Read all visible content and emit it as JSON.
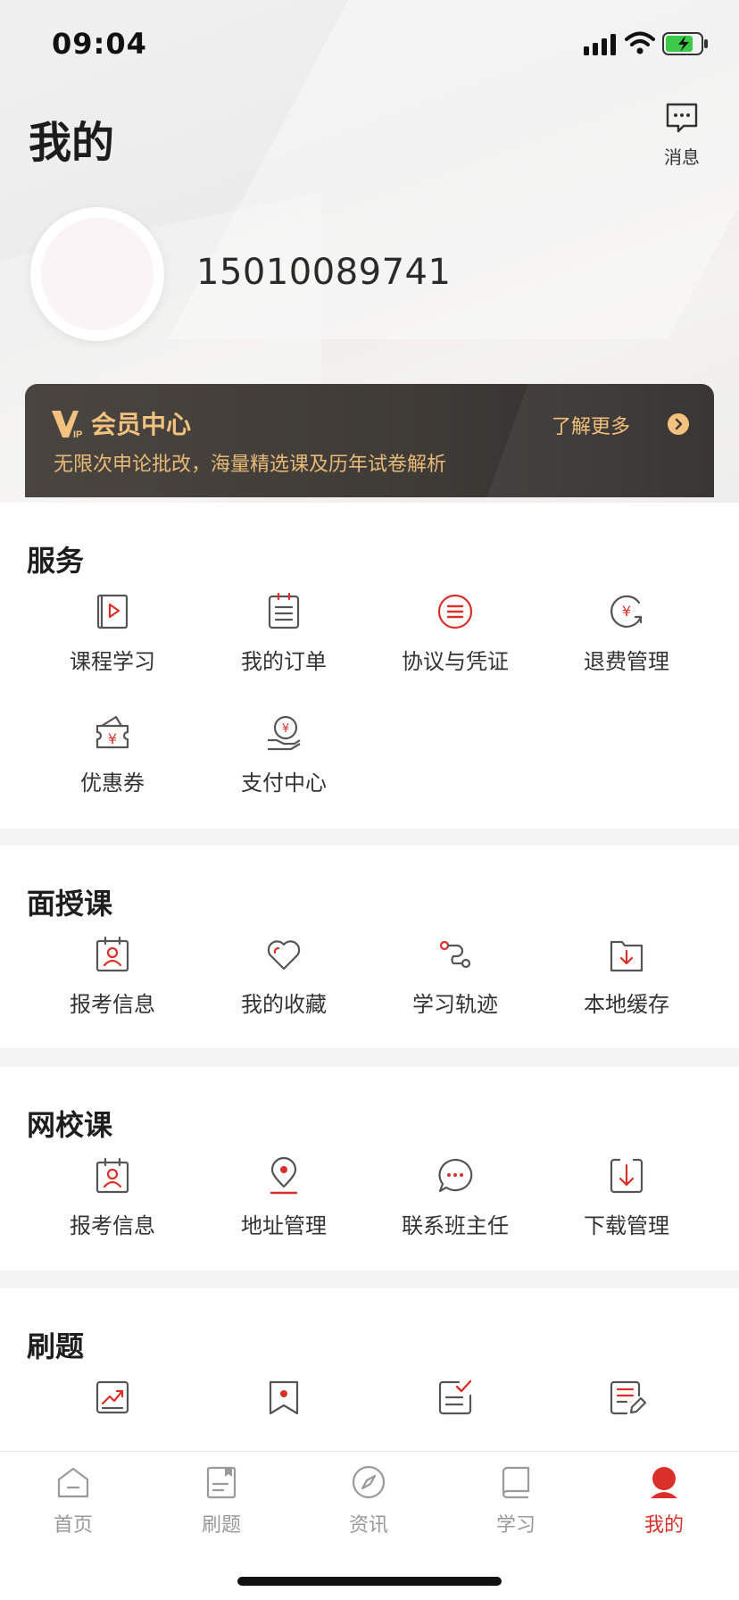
{
  "status_bar": {
    "time": "09:04"
  },
  "header": {
    "title": "我的",
    "message_label": "消息"
  },
  "profile": {
    "phone": "15010089741"
  },
  "vip": {
    "logo_text": "IP",
    "title": "会员中心",
    "subtitle": "无限次申论批改，海量精选课及历年试卷解析",
    "more_label": "了解更多"
  },
  "services": {
    "title": "服务",
    "items": [
      {
        "label": "课程学习",
        "icon": "video-book-icon"
      },
      {
        "label": "我的订单",
        "icon": "order-list-icon"
      },
      {
        "label": "协议与凭证",
        "icon": "agreement-icon"
      },
      {
        "label": "退费管理",
        "icon": "refund-icon"
      },
      {
        "label": "优惠券",
        "icon": "coupon-icon"
      },
      {
        "label": "支付中心",
        "icon": "payment-icon"
      }
    ]
  },
  "face_course": {
    "title": "面授课",
    "items": [
      {
        "label": "报考信息",
        "icon": "exam-info-icon"
      },
      {
        "label": "我的收藏",
        "icon": "heart-icon"
      },
      {
        "label": "学习轨迹",
        "icon": "track-icon"
      },
      {
        "label": "本地缓存",
        "icon": "folder-download-icon"
      }
    ]
  },
  "online_course": {
    "title": "网校课",
    "items": [
      {
        "label": "报考信息",
        "icon": "exam-info-icon"
      },
      {
        "label": "地址管理",
        "icon": "location-icon"
      },
      {
        "label": "联系班主任",
        "icon": "chat-icon"
      },
      {
        "label": "下载管理",
        "icon": "download-icon"
      }
    ]
  },
  "practice": {
    "title": "刷题",
    "items": [
      {
        "icon": "chart-icon"
      },
      {
        "icon": "bookmark-icon"
      },
      {
        "icon": "checklist-icon"
      },
      {
        "icon": "edit-note-icon"
      }
    ]
  },
  "tabbar": {
    "items": [
      {
        "label": "首页",
        "icon": "home-icon",
        "active": false
      },
      {
        "label": "刷题",
        "icon": "practice-icon",
        "active": false
      },
      {
        "label": "资讯",
        "icon": "compass-icon",
        "active": false
      },
      {
        "label": "学习",
        "icon": "book-icon",
        "active": false
      },
      {
        "label": "我的",
        "icon": "user-icon",
        "active": true
      }
    ]
  },
  "colors": {
    "accent": "#d9302a",
    "vip_gold": "#f3c27e",
    "icon_gray": "#555555"
  }
}
